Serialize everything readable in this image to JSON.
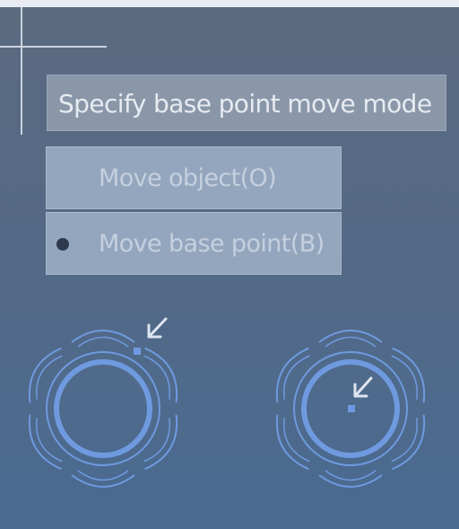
{
  "prompt": {
    "text": "Specify base point move mode"
  },
  "menu": {
    "items": [
      {
        "label": "Move object(O)",
        "selected": false
      },
      {
        "label": "Move base point(B)",
        "selected": true
      }
    ]
  },
  "colors": {
    "background_top": "#5b6b80",
    "background_bottom": "#4a6a91",
    "panel": "#93a6be",
    "text": "#c5d0de",
    "table_ring": "#6f9ae0",
    "base_point": "#6f9ae0",
    "arrow": "#dde6f0"
  },
  "icons": {
    "left_illustration": "round-table-with-chairs-icon",
    "right_illustration": "round-table-with-chairs-icon",
    "pointer": "arrow-pointer-icon"
  }
}
